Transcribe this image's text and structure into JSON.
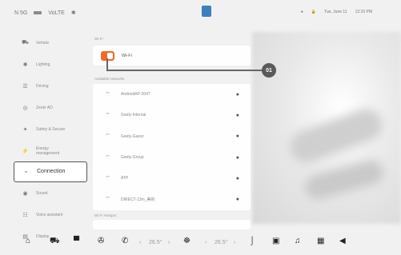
{
  "status_bar": {
    "left": [
      "N 5G",
      "SIM",
      "VoLTE",
      "BT"
    ],
    "right": [
      "●",
      "🔒",
      "Tue, June 11",
      "12:10 PM"
    ]
  },
  "sidebar": {
    "items": [
      {
        "icon": "car-icon",
        "glyph": "⛟",
        "label": "Vehicle"
      },
      {
        "icon": "lightbulb-icon",
        "glyph": "✺",
        "label": "Lighting"
      },
      {
        "icon": "steering-wheel-icon",
        "glyph": "☰",
        "label": "Driving"
      },
      {
        "icon": "seat-icon",
        "glyph": "◎",
        "label": "Zeekr AD"
      },
      {
        "icon": "shield-icon",
        "glyph": "✦",
        "label": "Safety & Secure"
      },
      {
        "icon": "battery-icon",
        "glyph": "⚡",
        "label": "Energy management"
      },
      {
        "icon": "link-icon",
        "glyph": "⌁",
        "label": "Connection"
      },
      {
        "icon": "speaker-icon",
        "glyph": "◉",
        "label": "Sound"
      },
      {
        "icon": "assistant-icon",
        "glyph": "☷",
        "label": "Voice assistant"
      },
      {
        "icon": "display-icon",
        "glyph": "▤",
        "label": "Display"
      }
    ]
  },
  "wifi": {
    "section_label": "Wi-Fi",
    "toggle_label": "Wi-Fi",
    "toggle_on": true
  },
  "networks": {
    "section_label": "Available networks",
    "items": [
      {
        "name": "AndroidAP-2047",
        "icon": "wifi-lock-icon"
      },
      {
        "name": "Geely-Internal",
        "icon": "wifi-icon"
      },
      {
        "name": "Geely-Guest",
        "icon": "wifi-icon"
      },
      {
        "name": "Geely-Group",
        "icon": "wifi-icon"
      },
      {
        "name": "ATP",
        "icon": "wifi-lock-icon"
      },
      {
        "name": "DIRECT-13m_美的",
        "icon": "wifi-lock-icon"
      }
    ]
  },
  "more_section_label": "Wi-Fi Hotspot",
  "callout": "01",
  "dock": {
    "left_temp": "26.5°",
    "right_temp": "26.5°"
  },
  "colors": {
    "accent": "#f26a2a",
    "callout": "#5a5a5a"
  }
}
